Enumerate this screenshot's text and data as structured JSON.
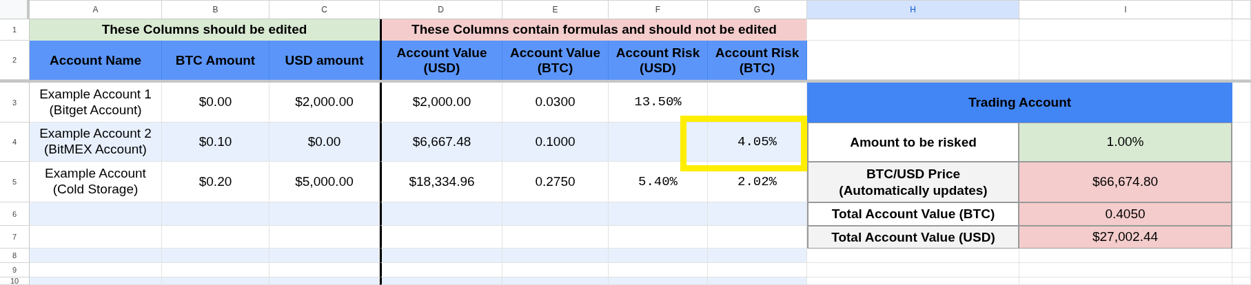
{
  "column_headers": [
    {
      "label": "A",
      "selected": false
    },
    {
      "label": "B",
      "selected": false
    },
    {
      "label": "C",
      "selected": false
    },
    {
      "label": "D",
      "selected": false
    },
    {
      "label": "E",
      "selected": false
    },
    {
      "label": "F",
      "selected": false
    },
    {
      "label": "G",
      "selected": false
    },
    {
      "label": "H",
      "selected": true
    },
    {
      "label": "I",
      "selected": false
    }
  ],
  "row_numbers": [
    "1",
    "2",
    "3",
    "4",
    "5",
    "6",
    "7",
    "8",
    "9",
    "10"
  ],
  "section_headers": [
    {
      "text": "These Columns should be edited",
      "kind": "editable"
    },
    {
      "text": "These Columns contain formulas and should not be edited",
      "kind": "formula"
    }
  ],
  "table": {
    "columns": [
      "Account Name",
      "BTC Amount",
      "USD amount",
      "Account Value\n(USD)",
      "Account Value\n(BTC)",
      "Account Risk\n(USD)",
      "Account Risk\n(BTC)"
    ],
    "rows": [
      {
        "cells": [
          "Example Account 1\n(Bitget Account)",
          "$0.00",
          "$2,000.00",
          "$2,000.00",
          "0.0300",
          "13.50%",
          ""
        ],
        "highlighted": false
      },
      {
        "cells": [
          "Example Account 2\n(BitMEX Account)",
          "$0.10",
          "$0.00",
          "$6,667.48",
          "0.1000",
          "",
          "4.05%"
        ],
        "highlighted": true
      },
      {
        "cells": [
          "Example Account\n(Cold Storage)",
          "$0.20",
          "$5,000.00",
          "$18,334.96",
          "0.2750",
          "5.40%",
          "2.02%"
        ],
        "highlighted": false
      }
    ]
  },
  "summary": {
    "title": "Trading Account",
    "rows": [
      {
        "label": "Amount to be risked",
        "value": "1.00%",
        "kind": "input"
      },
      {
        "label": "BTC/USD Price\n(Automatically updates)",
        "value": "$66,674.80",
        "kind": "formula"
      },
      {
        "label": "Total Account Value (BTC)",
        "value": "0.4050",
        "kind": "formula"
      },
      {
        "label": "Total Account Value (USD)",
        "value": "$27,002.44",
        "kind": "formula"
      }
    ]
  }
}
